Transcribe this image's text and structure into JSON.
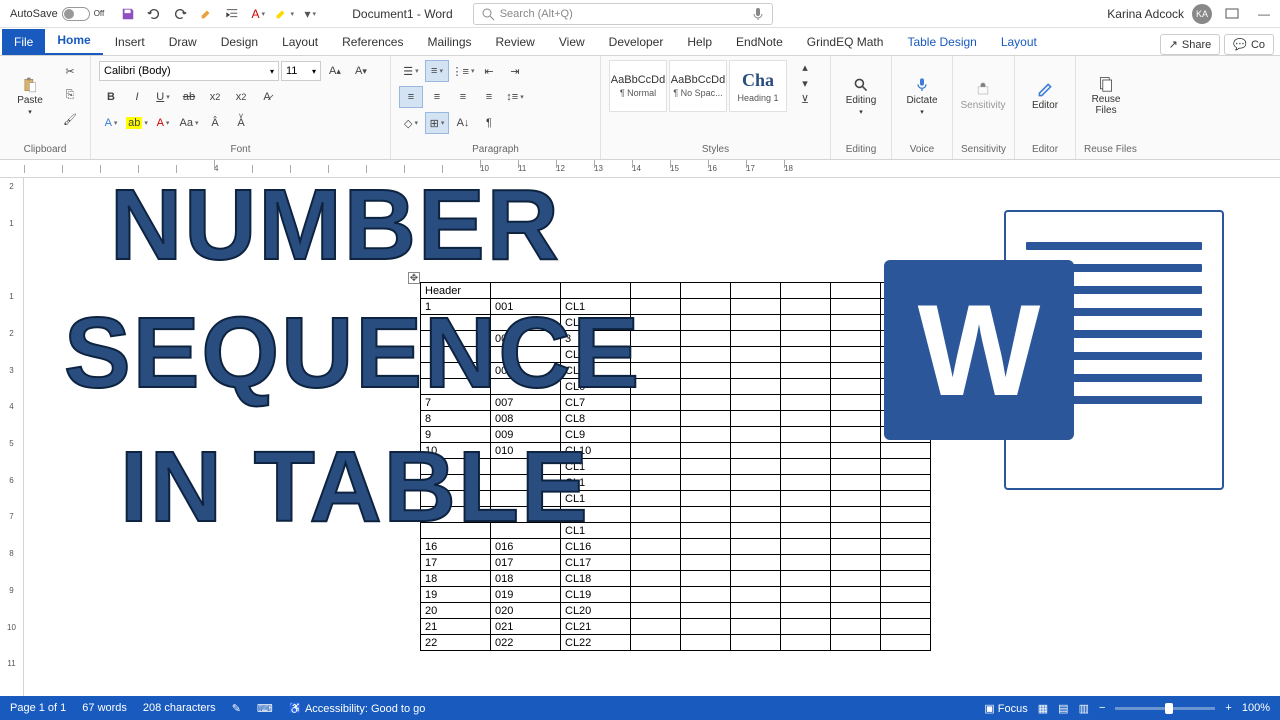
{
  "titlebar": {
    "autosave_label": "AutoSave",
    "autosave_state": "Off",
    "doc_title": "Document1 - Word",
    "search_placeholder": "Search (Alt+Q)",
    "user_name": "Karina Adcock",
    "user_initials": "KA"
  },
  "tabs": {
    "file": "File",
    "home": "Home",
    "insert": "Insert",
    "draw": "Draw",
    "design": "Design",
    "layout": "Layout",
    "references": "References",
    "mailings": "Mailings",
    "review": "Review",
    "view": "View",
    "developer": "Developer",
    "help": "Help",
    "endnote": "EndNote",
    "grindeq": "GrindEQ Math",
    "table_design": "Table Design",
    "table_layout": "Layout",
    "share": "Share",
    "comments": "Co"
  },
  "ribbon": {
    "clipboard": {
      "label": "Clipboard",
      "paste": "Paste"
    },
    "font": {
      "label": "Font",
      "name": "Calibri (Body)",
      "size": "11"
    },
    "paragraph": {
      "label": "Paragraph"
    },
    "styles": {
      "label": "Styles",
      "items": [
        {
          "preview": "AaBbCcDd",
          "name": "¶ Normal"
        },
        {
          "preview": "AaBbCcDd",
          "name": "¶ No Spac..."
        },
        {
          "preview": "Cha",
          "name": "Heading 1"
        }
      ]
    },
    "editing": {
      "label": "Editing",
      "btn": "Editing"
    },
    "voice": {
      "label": "Voice",
      "btn": "Dictate"
    },
    "sensitivity": {
      "label": "Sensitivity",
      "btn": "Sensitivity"
    },
    "editor": {
      "label": "Editor",
      "btn": "Editor"
    },
    "reuse": {
      "label": "Reuse Files",
      "btn": "Reuse\nFiles"
    }
  },
  "ruler_h": [
    "",
    "",
    "",
    "",
    "",
    "4",
    "",
    "",
    "",
    "",
    "",
    "",
    "10",
    "11",
    "12",
    "13",
    "14",
    "15",
    "16",
    "17",
    "18"
  ],
  "ruler_v": [
    "2",
    "1",
    "",
    "1",
    "2",
    "3",
    "4",
    "5",
    "6",
    "7",
    "8",
    "9",
    "10",
    "11"
  ],
  "table": {
    "header": "Header",
    "rows": [
      {
        "n": "1",
        "p": "001",
        "c": "CL1"
      },
      {
        "n": "",
        "p": "",
        "c": "CL2"
      },
      {
        "n": "",
        "p": "003",
        "c": "3"
      },
      {
        "n": "",
        "p": "",
        "c": "CL"
      },
      {
        "n": "",
        "p": "005",
        "c": "CL"
      },
      {
        "n": "",
        "p": "",
        "c": "CL6"
      },
      {
        "n": "7",
        "p": "007",
        "c": "CL7"
      },
      {
        "n": "8",
        "p": "008",
        "c": "CL8"
      },
      {
        "n": "9",
        "p": "009",
        "c": "CL9"
      },
      {
        "n": "10",
        "p": "010",
        "c": "CL10"
      },
      {
        "n": "",
        "p": "",
        "c": "CL1"
      },
      {
        "n": "",
        "p": "",
        "c": "CL1"
      },
      {
        "n": "",
        "p": "",
        "c": "CL1"
      },
      {
        "n": "",
        "p": "",
        "c": "CL1"
      },
      {
        "n": "",
        "p": "",
        "c": "CL1"
      },
      {
        "n": "16",
        "p": "016",
        "c": "CL16"
      },
      {
        "n": "17",
        "p": "017",
        "c": "CL17"
      },
      {
        "n": "18",
        "p": "018",
        "c": "CL18"
      },
      {
        "n": "19",
        "p": "019",
        "c": "CL19"
      },
      {
        "n": "20",
        "p": "020",
        "c": "CL20"
      },
      {
        "n": "21",
        "p": "021",
        "c": "CL21"
      },
      {
        "n": "22",
        "p": "022",
        "c": "CL22"
      }
    ]
  },
  "overlay": {
    "l1": "NUMBER",
    "l2": "SEQUENCE",
    "l3": "IN TABLE"
  },
  "logo_letter": "W",
  "status": {
    "page": "Page 1 of 1",
    "words": "67 words",
    "chars": "208 characters",
    "accessibility": "Accessibility: Good to go",
    "focus": "Focus",
    "zoom": "100%"
  }
}
